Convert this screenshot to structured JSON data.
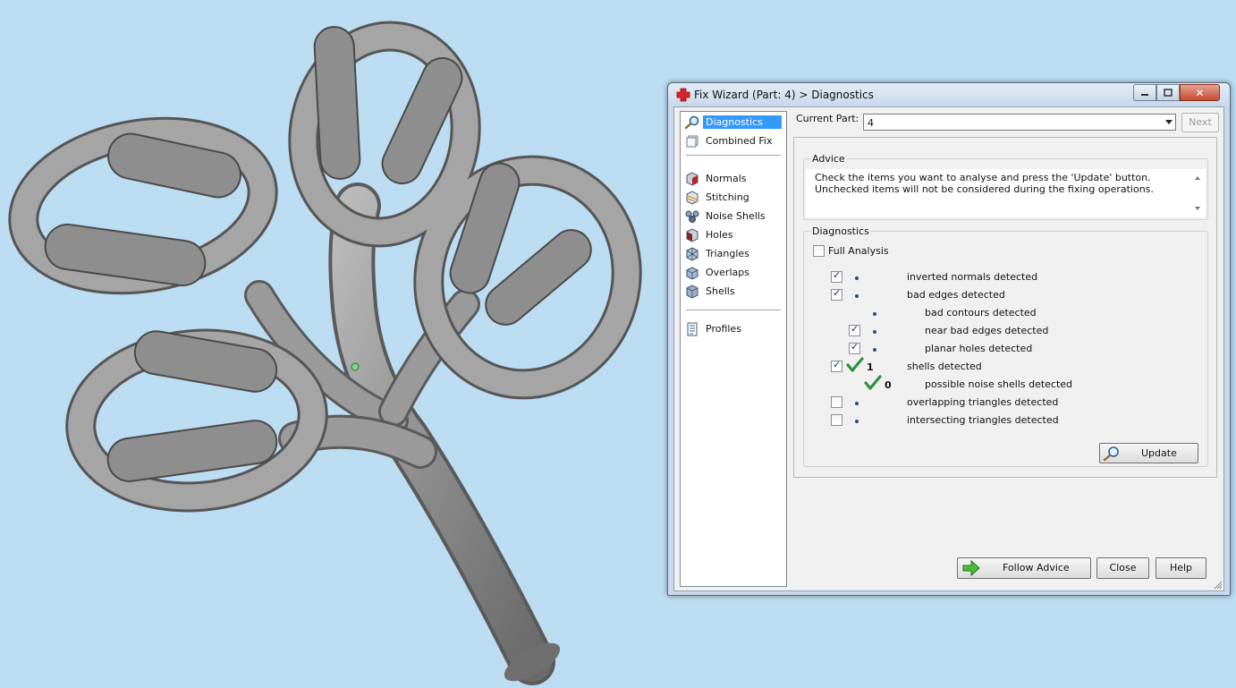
{
  "dialog": {
    "title": "Fix Wizard (Part: 4) > Diagnostics",
    "accent": "#3399ff"
  },
  "nav": {
    "primary": [
      {
        "label": "Diagnostics",
        "icon": "magnifier-icon",
        "selected": true
      },
      {
        "label": "Combined Fix",
        "icon": "combined-fix-icon"
      }
    ],
    "fixes": [
      {
        "label": "Normals",
        "icon": "normals-icon"
      },
      {
        "label": "Stitching",
        "icon": "stitching-icon"
      },
      {
        "label": "Noise Shells",
        "icon": "noise-shells-icon"
      },
      {
        "label": "Holes",
        "icon": "holes-icon"
      },
      {
        "label": "Triangles",
        "icon": "triangles-icon"
      },
      {
        "label": "Overlaps",
        "icon": "overlaps-icon"
      },
      {
        "label": "Shells",
        "icon": "shells-icon"
      }
    ],
    "extra": [
      {
        "label": "Profiles",
        "icon": "profiles-icon"
      }
    ]
  },
  "header": {
    "current_part_label": "Current Part:",
    "current_part_value": "4",
    "next_label": "Next"
  },
  "advice": {
    "legend": "Advice",
    "text": "Check the items you want to analyse and press the 'Update' button. Unchecked items will not be considered during the fixing operations."
  },
  "diagnostics": {
    "legend": "Diagnostics",
    "full_analysis_label": "Full Analysis",
    "full_analysis_checked": false,
    "rows": [
      {
        "label": "inverted normals detected",
        "checked": true,
        "has_checkbox": true,
        "indent": 0,
        "status": "bullet",
        "count": ""
      },
      {
        "label": "bad edges detected",
        "checked": true,
        "has_checkbox": true,
        "indent": 0,
        "status": "bullet",
        "count": ""
      },
      {
        "label": "bad contours detected",
        "checked": false,
        "has_checkbox": false,
        "indent": 1,
        "status": "bullet",
        "count": ""
      },
      {
        "label": "near bad edges detected",
        "checked": true,
        "has_checkbox": true,
        "indent": 1,
        "status": "bullet",
        "count": ""
      },
      {
        "label": "planar holes detected",
        "checked": true,
        "has_checkbox": true,
        "indent": 1,
        "status": "bullet",
        "count": ""
      },
      {
        "label": "shells detected",
        "checked": true,
        "has_checkbox": true,
        "indent": 0,
        "status": "ok",
        "count": "1"
      },
      {
        "label": "possible noise shells detected",
        "checked": false,
        "has_checkbox": false,
        "indent": 1,
        "status": "ok",
        "count": "0"
      },
      {
        "label": "overlapping triangles detected",
        "checked": false,
        "has_checkbox": true,
        "indent": 0,
        "status": "bullet",
        "count": ""
      },
      {
        "label": "intersecting triangles detected",
        "checked": false,
        "has_checkbox": true,
        "indent": 0,
        "status": "bullet",
        "count": ""
      }
    ],
    "update_label": "Update"
  },
  "footer": {
    "follow_advice_label": "Follow Advice",
    "close_label": "Close",
    "help_label": "Help"
  },
  "colors": {
    "viewport_background": "#bcdcf2",
    "model_gray": "#8a8a8a",
    "ok_green": "#2f8f3a",
    "bullet_blue": "#2b4a8b"
  }
}
